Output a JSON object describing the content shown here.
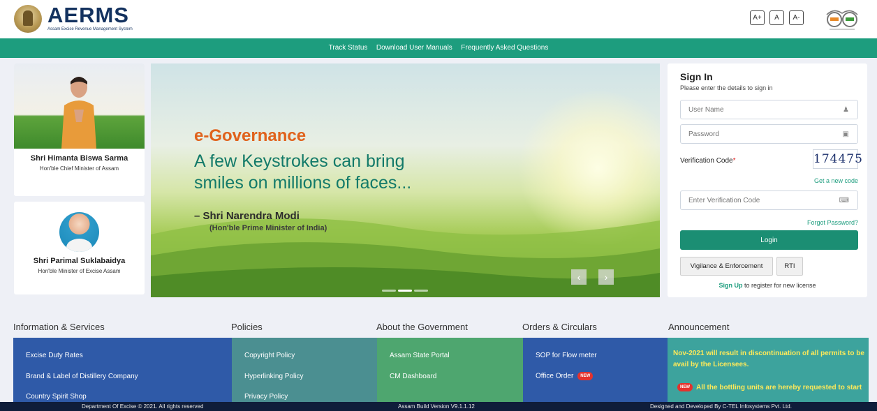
{
  "header": {
    "logo_text": "AERMS",
    "logo_subtitle": "Assam Excise Revenue Management System",
    "font_sizes": [
      "A+",
      "A",
      "A-"
    ]
  },
  "topnav": {
    "items": [
      "Track Status",
      "Download User Manuals",
      "Frequently Asked Questions"
    ]
  },
  "leaders": [
    {
      "name": "Shri Himanta Biswa Sarma",
      "role": "Hon'ble Chief Minister of Assam"
    },
    {
      "name": "Shri Parimal Suklabaidya",
      "role": "Hon'ble Minister of Excise Assam"
    }
  ],
  "banner": {
    "title": "e-Governance",
    "quote_line1": "A few Keystrokes can bring",
    "quote_line2": "smiles on millions of faces...",
    "author": "– Shri Narendra Modi",
    "author_role": "(Hon'ble Prime Minister of India)",
    "prev": "‹",
    "next": "›"
  },
  "signin": {
    "title": "Sign In",
    "subtitle": "Please enter the details to sign in",
    "username_placeholder": "User Name",
    "password_placeholder": "Password",
    "verification_label": "Verification Code",
    "required_mark": "*",
    "captcha": "174475",
    "new_code": "Get a new code",
    "code_placeholder": "Enter Verification Code",
    "forgot": "Forgot Password?",
    "login": "Login",
    "vigilance": "Vigilance & Enforcement",
    "rti": "RTI",
    "signup_link": "Sign Up",
    "signup_rest": " to register for new license"
  },
  "sections": {
    "info": {
      "title": "Information & Services",
      "color": "#2f5aa8",
      "items": [
        "Excise Duty Rates",
        "Brand & Label of Distillery Company",
        "Country Spirit Shop"
      ]
    },
    "policies": {
      "title": "Policies",
      "color": "#4b8f91",
      "items": [
        "Copyright Policy",
        "Hyperlinking Policy",
        "Privacy Policy"
      ]
    },
    "about": {
      "title": "About the Government",
      "color": "#4ea66f",
      "items": [
        "Assam State Portal",
        "CM Dashboard"
      ]
    },
    "orders": {
      "title": "Orders & Circulars",
      "color": "#2f5aa8",
      "items": [
        "SOP for Flow meter",
        "Office Order"
      ],
      "badge": "NEW"
    },
    "announcement": {
      "title": "Announcement",
      "color": "#3da39d",
      "text1": "Nov-2021 will result in discontinuation of all permits to be avail by the Licensees.",
      "badge": "NEW",
      "text2": "All the bottling units are hereby requested to start"
    }
  },
  "footer": {
    "left": "Department Of Excise © 2021. All rights reserved",
    "center": "Assam Build Version V9.1.1.12",
    "right": "Designed and Developed By C-TEL Infosystems Pvt. Ltd."
  }
}
